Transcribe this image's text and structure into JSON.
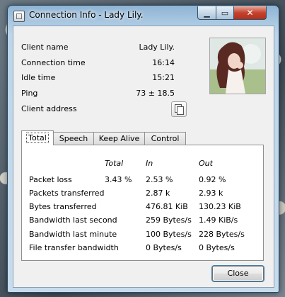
{
  "window": {
    "title": "Connection Info - Lady Lily."
  },
  "info": [
    {
      "label": "Client name",
      "value": "Lady Lily."
    },
    {
      "label": "Connection time",
      "value": "16:14"
    },
    {
      "label": "Idle time",
      "value": "15:21"
    },
    {
      "label": "Ping",
      "value": "73 ± 18.5"
    },
    {
      "label": "Client address",
      "value": ""
    }
  ],
  "tabs": [
    "Total",
    "Speech",
    "Keep Alive",
    "Control"
  ],
  "stats": {
    "headers": {
      "total": "Total",
      "in": "In",
      "out": "Out"
    },
    "rows": [
      {
        "label": "Packet loss",
        "total": "3.43 %",
        "in": "2.53 %",
        "out": "0.92 %"
      },
      {
        "label": "Packets transferred",
        "total": "",
        "in": "2.87 k",
        "out": "2.93 k"
      },
      {
        "label": "Bytes transferred",
        "total": "",
        "in": "476.81 KiB",
        "out": "130.23 KiB"
      },
      {
        "label": "Bandwidth last second",
        "total": "",
        "in": "259 Bytes/s",
        "out": "1.49 KiB/s"
      },
      {
        "label": "Bandwidth last minute",
        "total": "",
        "in": "100 Bytes/s",
        "out": "228 Bytes/s"
      },
      {
        "label": "File transfer bandwidth",
        "total": "",
        "in": "0 Bytes/s",
        "out": "0 Bytes/s"
      }
    ]
  },
  "buttons": {
    "close": "Close"
  },
  "icons": {
    "app": "app-window-icon",
    "copy": "copy-icon",
    "minimize": "minimize-icon",
    "maximize": "maximize-icon",
    "close": "close-icon"
  }
}
